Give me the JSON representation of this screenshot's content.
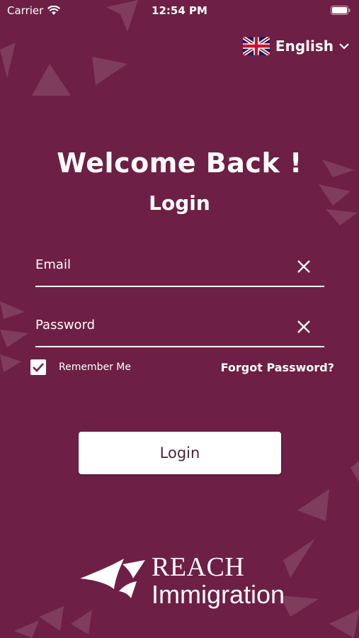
{
  "status_bar": {
    "carrier": "Carrier",
    "time": "12:54 PM"
  },
  "language": {
    "label": "English",
    "flag": "uk-flag-icon"
  },
  "heading": {
    "title": "Welcome Back !",
    "subtitle": "Login"
  },
  "form": {
    "email_placeholder": "Email",
    "password_placeholder": "Password",
    "remember_label": "Remember Me",
    "remember_checked": true,
    "forgot_label": "Forgot Password?",
    "login_label": "Login"
  },
  "logo": {
    "line1": "REACH",
    "line2": "Immigration"
  },
  "colors": {
    "background": "#6e1f45",
    "accent": "#ffffff",
    "button_text": "#4a2438"
  }
}
